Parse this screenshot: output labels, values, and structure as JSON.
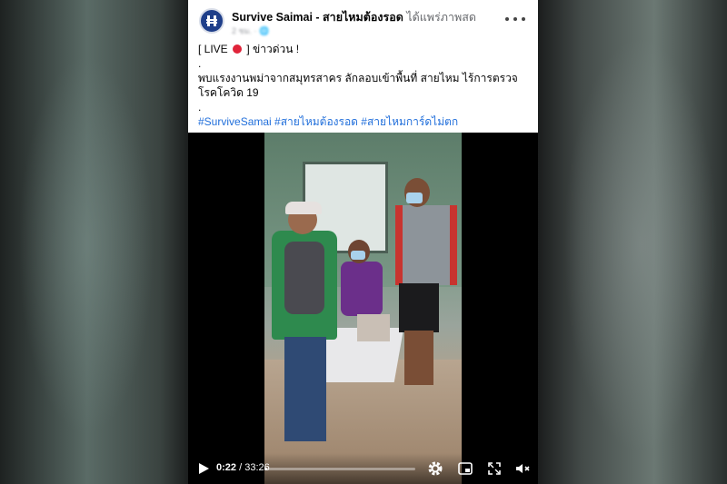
{
  "post": {
    "page_name": "Survive Saimai - สายไหมต้องรอด",
    "action_text": "ได้แพร่ภาพสด",
    "timestamp": "2 ชม. · 🌐",
    "lines": [
      "[ LIVE",
      "]  ข่าวด่วน !",
      ".",
      "พบแรงงานพม่าจากสมุทรสาคร ลักลอบเข้าพื้นที่ สายไหม ไร้การตรวจโรคโควิด 19",
      "."
    ],
    "hashtags": "#SurviveSamai #สายไหมต้องรอด #สายไหมการ์ดไม่ตก"
  },
  "video": {
    "current_time": "0:22",
    "separator": " / ",
    "duration": "33:26",
    "progress": 0.011,
    "icons": [
      "play-icon",
      "settings-icon",
      "picture-in-picture-icon",
      "fullscreen-icon",
      "mute-icon"
    ]
  }
}
